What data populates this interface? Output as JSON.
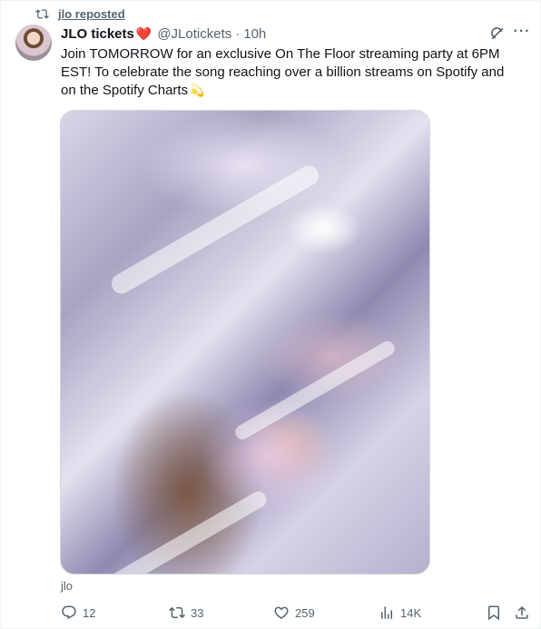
{
  "repost_line": {
    "icon": "repost-icon",
    "text": "jlo reposted"
  },
  "tweet": {
    "display_name": "JLO tickets",
    "name_emoji": "❤️",
    "handle": "@JLotickets",
    "separator": "·",
    "time": "10h",
    "text": "Join TOMORROW for an exclusive On The Floor streaming party at 6PM EST! To celebrate the song reaching over a billion streams on Spotify and on the Spotify Charts",
    "text_emoji": "💫",
    "media_caption": "jlo"
  },
  "actions": {
    "reply_count": "12",
    "repost_count": "33",
    "like_count": "259",
    "views_count": "14K"
  },
  "icons": {
    "grok": "grok-icon",
    "more": "more-icon",
    "reply": "reply-icon",
    "repost": "repost-icon",
    "like": "heart-icon",
    "views": "views-icon",
    "bookmark": "bookmark-icon",
    "share": "share-icon"
  },
  "colors": {
    "text": "#0f1419",
    "secondary": "#536471",
    "heart": "#e0245e",
    "border": "#cfd9de"
  }
}
